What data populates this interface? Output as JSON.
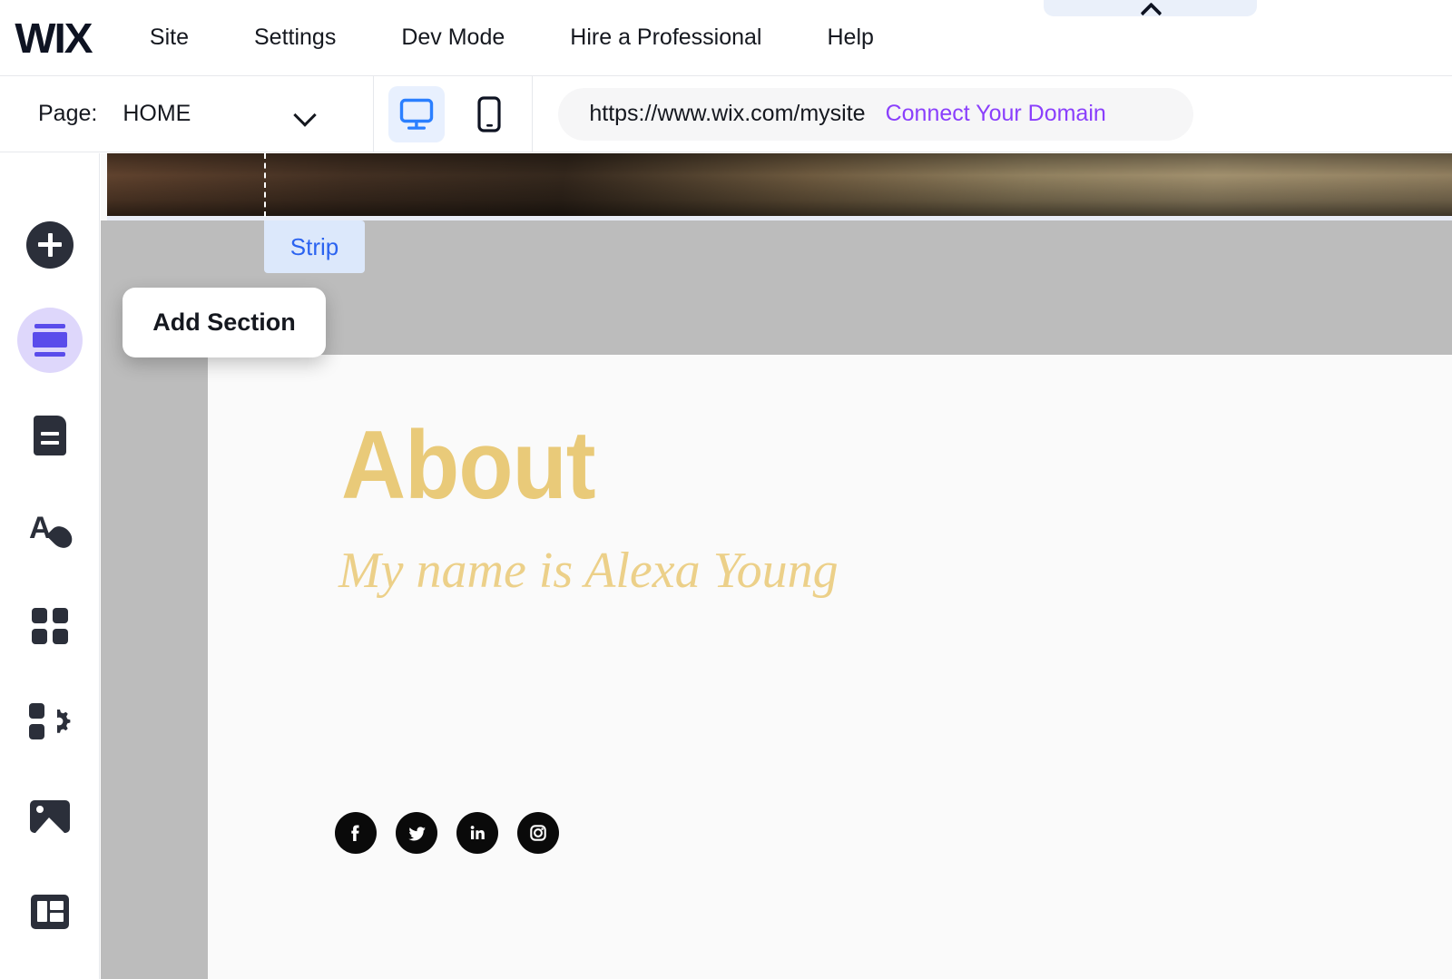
{
  "app": {
    "logo": "WIX"
  },
  "topmenu": {
    "items": [
      {
        "label": "Site",
        "name": "menu-site"
      },
      {
        "label": "Settings",
        "name": "menu-settings"
      },
      {
        "label": "Dev Mode",
        "name": "menu-dev-mode"
      },
      {
        "label": "Hire a Professional",
        "name": "menu-hire-a-professional"
      },
      {
        "label": "Help",
        "name": "menu-help"
      }
    ]
  },
  "collapse_panel": {
    "icon": "chevron-up-icon"
  },
  "secondbar": {
    "page_label": "Page:",
    "page_value": "HOME",
    "page_caret_icon": "chevron-down-icon",
    "devices": [
      {
        "name": "desktop-view-toggle",
        "icon": "desktop-icon",
        "active": true
      },
      {
        "name": "mobile-view-toggle",
        "icon": "mobile-icon",
        "active": false
      }
    ],
    "url": "https://www.wix.com/mysite",
    "connect_domain": "Connect Your Domain"
  },
  "sidebar": {
    "items": [
      {
        "label": "Add",
        "icon": "plus-icon",
        "name": "sidebar-item-add",
        "active": false
      },
      {
        "label": "Add Section",
        "icon": "sections-icon",
        "name": "sidebar-item-sections",
        "active": true
      },
      {
        "label": "Pages",
        "icon": "page-document-icon",
        "name": "sidebar-item-pages",
        "active": false
      },
      {
        "label": "Site Design",
        "icon": "theme-letter-a-droplet-icon",
        "name": "sidebar-item-site-design",
        "active": false
      },
      {
        "label": "Apps",
        "icon": "grid-four-squares-icon",
        "name": "sidebar-item-apps",
        "active": false
      },
      {
        "label": "Add Apps",
        "icon": "apps-gear-icon",
        "name": "sidebar-item-add-apps",
        "active": false
      },
      {
        "label": "Media",
        "icon": "image-icon",
        "name": "sidebar-item-media",
        "active": false
      },
      {
        "label": "Content Manager",
        "icon": "table-grid-icon",
        "name": "sidebar-item-content-manager",
        "active": false
      }
    ]
  },
  "canvas": {
    "strip_tag": "Strip",
    "add_section_tooltip": "Add Section",
    "about_title": "About",
    "about_subtitle": "My name is Alexa Young",
    "social": [
      {
        "label": "Facebook",
        "icon": "facebook-icon",
        "name": "social-facebook"
      },
      {
        "label": "Twitter",
        "icon": "twitter-icon",
        "name": "social-twitter"
      },
      {
        "label": "LinkedIn",
        "icon": "linkedin-icon",
        "name": "social-linkedin"
      },
      {
        "label": "Instagram",
        "icon": "instagram-icon",
        "name": "social-instagram"
      }
    ]
  },
  "colors": {
    "brand_purple": "#8a3ffc",
    "active_violet": "#5a4ceb",
    "device_blue": "#2b7fff",
    "strip_tag_blue": "#2b63f0",
    "gold": "#e9ca79",
    "gold_light": "#ecd089",
    "gray_band": "#bcbcbc"
  }
}
